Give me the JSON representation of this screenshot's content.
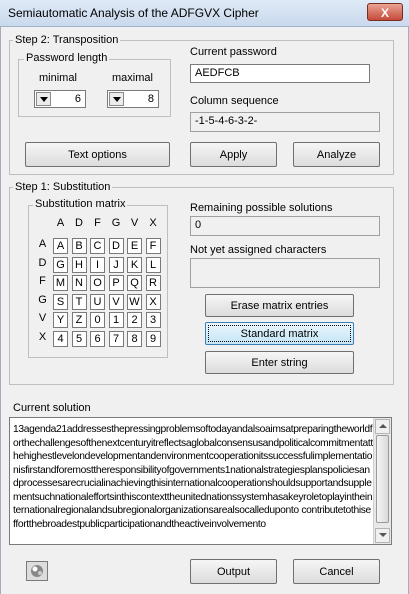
{
  "window": {
    "title": "Semiautomatic Analysis of the ADFGVX Cipher",
    "close": "X"
  },
  "step2": {
    "legend": "Step 2: Transposition",
    "password_length": {
      "legend": "Password length",
      "minimal_label": "minimal",
      "maximal_label": "maximal",
      "minimal": "6",
      "maximal": "8"
    },
    "current_password_label": "Current password",
    "current_password": "AEDFCB",
    "column_sequence_label": "Column sequence",
    "column_sequence": "-1-5-4-6-3-2-",
    "buttons": {
      "text_options": "Text options",
      "apply": "Apply",
      "analyze": "Analyze"
    }
  },
  "step1": {
    "legend": "Step 1: Substitution",
    "matrix_legend": "Substitution matrix",
    "col_headers": [
      "A",
      "D",
      "F",
      "G",
      "V",
      "X"
    ],
    "row_headers": [
      "A",
      "D",
      "F",
      "G",
      "V",
      "X"
    ],
    "matrix": [
      [
        "A",
        "B",
        "C",
        "D",
        "E",
        "F"
      ],
      [
        "G",
        "H",
        "I",
        "J",
        "K",
        "L"
      ],
      [
        "M",
        "N",
        "O",
        "P",
        "Q",
        "R"
      ],
      [
        "S",
        "T",
        "U",
        "V",
        "W",
        "X"
      ],
      [
        "Y",
        "Z",
        "0",
        "1",
        "2",
        "3"
      ],
      [
        "4",
        "5",
        "6",
        "7",
        "8",
        "9"
      ]
    ],
    "remaining_label": "Remaining possible solutions",
    "remaining_value": "0",
    "not_assigned_label": "Not yet assigned characters",
    "not_assigned_value": "",
    "buttons": {
      "erase": "Erase matrix entries",
      "standard": "Standard matrix",
      "enter": "Enter string"
    }
  },
  "solution": {
    "label": "Current solution",
    "text": "13agenda21addressesthepressingproblemsoftodayandalsoaimsatpreparingtheworldforthechallengesofthenextcenturyitreflectsaglobalconsensusandpoliticalcommitmentatthehighestlevelondevelopmentandenvironmentcooperationitssuccessfulimplementationisfirstandforemosttheresponsibilityofgovernments1nationalstrategiesplanspoliciesandprocessesarecrucialinachievingthisinternationalcooperationshouldsupportandsupplementsuchnationaleffortsinthiscontexttheunitednationssystemhasakeyroletoplayintheinternationalregionalandsubregionalorganizationsarealsocalleduponto contributetothiseffortthebroadestpublicparticipationandtheactiveinvolvemento"
  },
  "bottom": {
    "icon": "tool-icon",
    "output": "Output",
    "cancel": "Cancel"
  }
}
